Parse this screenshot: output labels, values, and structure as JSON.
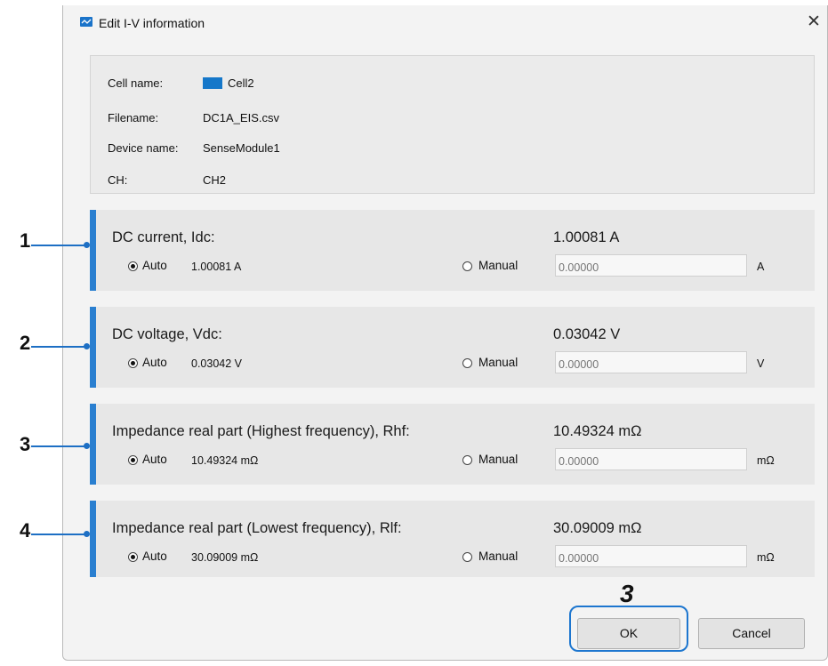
{
  "window": {
    "title": "Edit I-V information",
    "close_glyph": "✕",
    "icon": "chart-line-icon"
  },
  "info": {
    "rows": [
      {
        "label": "Cell name:",
        "value": "Cell2",
        "swatch_color": "#1577c9"
      },
      {
        "label": "Filename:",
        "value": "DC1A_EIS.csv"
      },
      {
        "label": "Device name:",
        "value": "SenseModule1"
      },
      {
        "label": "CH:",
        "value": "CH2"
      }
    ]
  },
  "sections": [
    {
      "callout": "1",
      "title": "DC current, Idc:",
      "value": "1.00081 A",
      "auto_label": "Auto",
      "auto_value": "1.00081 A",
      "manual_label": "Manual",
      "manual_placeholder": "0.00000",
      "unit": "A"
    },
    {
      "callout": "2",
      "title": "DC voltage, Vdc:",
      "value": "0.03042 V",
      "auto_label": "Auto",
      "auto_value": "0.03042 V",
      "manual_label": "Manual",
      "manual_placeholder": "0.00000",
      "unit": "V"
    },
    {
      "callout": "3",
      "title": "Impedance real part (Highest frequency), Rhf:",
      "value": "10.49324 mΩ",
      "auto_label": "Auto",
      "auto_value": "10.49324 mΩ",
      "manual_label": "Manual",
      "manual_placeholder": "0.00000",
      "unit": "mΩ"
    },
    {
      "callout": "4",
      "title": "Impedance real part (Lowest frequency), Rlf:",
      "value": "30.09009 mΩ",
      "auto_label": "Auto",
      "auto_value": "30.09009 mΩ",
      "manual_label": "Manual",
      "manual_placeholder": "0.00000",
      "unit": "mΩ"
    }
  ],
  "buttons": {
    "ok": "OK",
    "cancel": "Cancel"
  },
  "step_marker": "3",
  "colors": {
    "accent": "#2a7fd0",
    "callout_line": "#1d6fc4"
  }
}
